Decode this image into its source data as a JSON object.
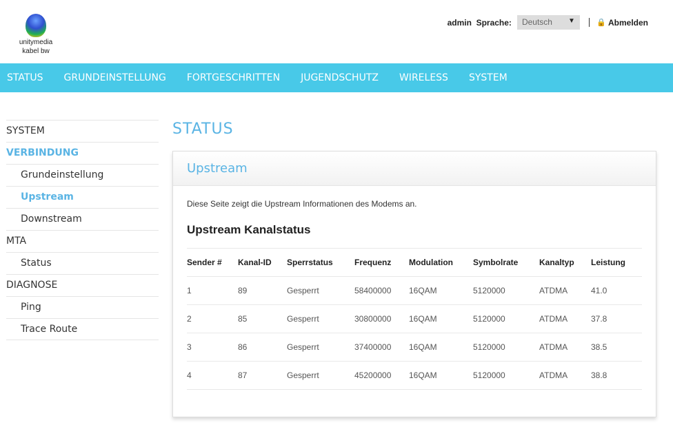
{
  "logo": {
    "line1": "unitymedia",
    "line2": "kabel bw"
  },
  "topbar": {
    "user": "admin",
    "language_label": "Sprache:",
    "language_value": "Deutsch",
    "logout": "Abmelden"
  },
  "nav": [
    "STATUS",
    "GRUNDEINSTELLUNG",
    "FORTGESCHRITTEN",
    "JUGENDSCHUTZ",
    "WIRELESS",
    "SYSTEM"
  ],
  "sidebar": [
    {
      "label": "SYSTEM",
      "sub": false,
      "active": false
    },
    {
      "label": "VERBINDUNG",
      "sub": false,
      "active": true
    },
    {
      "label": "Grundeinstellung",
      "sub": true,
      "active": false
    },
    {
      "label": "Upstream",
      "sub": true,
      "active": true
    },
    {
      "label": "Downstream",
      "sub": true,
      "active": false
    },
    {
      "label": "MTA",
      "sub": false,
      "active": false
    },
    {
      "label": "Status",
      "sub": true,
      "active": false
    },
    {
      "label": "DIAGNOSE",
      "sub": false,
      "active": false
    },
    {
      "label": "Ping",
      "sub": true,
      "active": false
    },
    {
      "label": "Trace Route",
      "sub": true,
      "active": false
    }
  ],
  "page_title": "STATUS",
  "panel": {
    "title": "Upstream",
    "description": "Diese Seite zeigt die Upstream Informationen des Modems an.",
    "table_title": "Upstream Kanalstatus",
    "columns": [
      "Sender #",
      "Kanal-ID",
      "Sperrstatus",
      "Frequenz",
      "Modulation",
      "Symbolrate",
      "Kanaltyp",
      "Leistung"
    ],
    "rows": [
      [
        "1",
        "89",
        "Gesperrt",
        "58400000",
        "16QAM",
        "5120000",
        "ATDMA",
        "41.0"
      ],
      [
        "2",
        "85",
        "Gesperrt",
        "30800000",
        "16QAM",
        "5120000",
        "ATDMA",
        "37.8"
      ],
      [
        "3",
        "86",
        "Gesperrt",
        "37400000",
        "16QAM",
        "5120000",
        "ATDMA",
        "38.5"
      ],
      [
        "4",
        "87",
        "Gesperrt",
        "45200000",
        "16QAM",
        "5120000",
        "ATDMA",
        "38.8"
      ]
    ]
  }
}
